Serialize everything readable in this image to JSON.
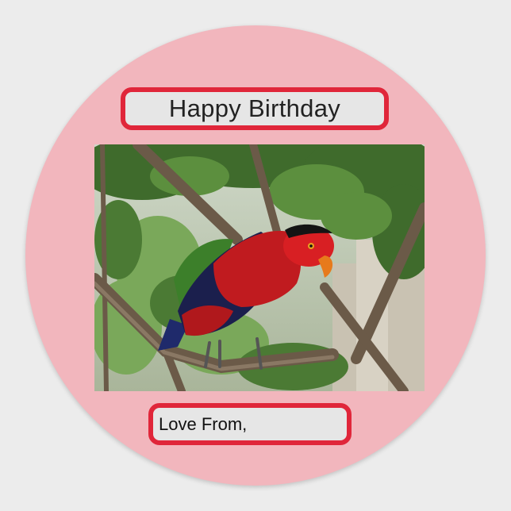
{
  "sticker": {
    "title": "Happy Birthday",
    "footer": "Love From,"
  },
  "colors": {
    "sticker_background": "#f2b6bd",
    "label_border": "#e0263a",
    "label_fill": "#e6e6e6"
  },
  "photo": {
    "subject": "red-and-black lory parrot perched on a tree branch"
  }
}
